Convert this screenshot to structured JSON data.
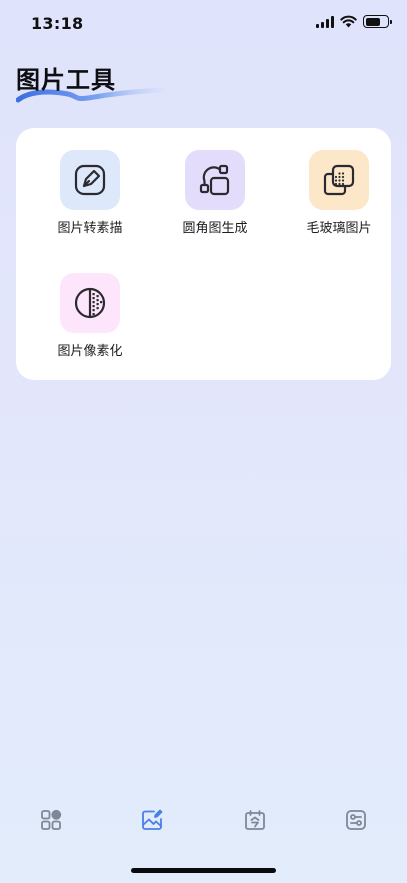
{
  "status_bar": {
    "time": "13:18"
  },
  "page": {
    "title": "图片工具"
  },
  "tools": [
    {
      "label": "图片转素描",
      "icon": "sketch-icon",
      "tile_color": "#dde8fb"
    },
    {
      "label": "圆角图生成",
      "icon": "rounded-corner-icon",
      "tile_color": "#e4dcfb"
    },
    {
      "label": "毛玻璃图片",
      "icon": "frosted-glass-icon",
      "tile_color": "#fde7c9"
    },
    {
      "label": "图片像素化",
      "icon": "pixelate-icon",
      "tile_color": "#fde6fb"
    }
  ],
  "tab_bar": {
    "active_index": 1,
    "tabs": [
      {
        "icon": "grid-apps-icon"
      },
      {
        "icon": "image-edit-icon"
      },
      {
        "icon": "calendar-icon"
      },
      {
        "icon": "settings-toggle-icon"
      }
    ]
  },
  "colors": {
    "accent": "#4a7ee8",
    "inactive": "#7f8796"
  }
}
